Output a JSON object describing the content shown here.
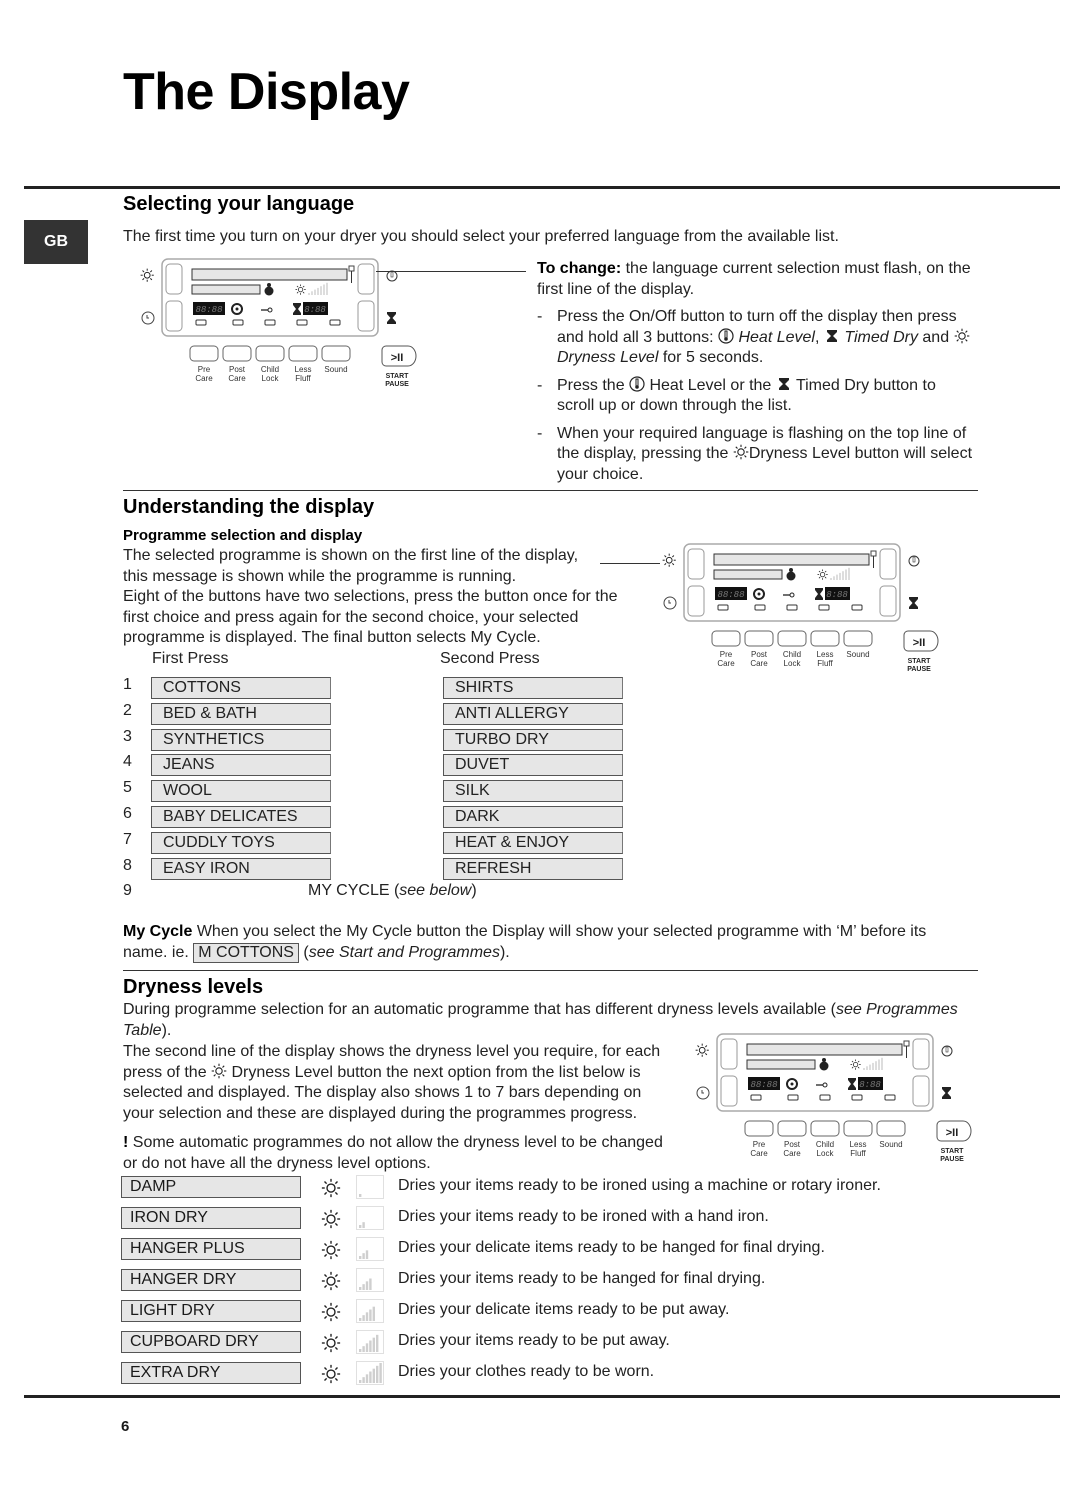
{
  "page": {
    "title": "The Display",
    "side_tab": "GB",
    "page_number": "6"
  },
  "language": {
    "heading": "Selecting your language",
    "intro": "The first time you turn on your dryer you should select your preferred language from the available list.",
    "to_change_label": "To change:",
    "to_change_text": " the language current selection must flash, on the first line of the display.",
    "steps": [
      {
        "dash": "-",
        "p1": "Press the On/Off button to turn off the display then press and hold all 3 buttons: ",
        "heat": "Heat Level",
        "comma": ", ",
        "timed": "Timed Dry",
        "and": " and ",
        "dryness": "Dryness Level",
        "tail": " for 5 seconds."
      },
      {
        "dash": "-",
        "p1": "Press the ",
        "p2": " Heat Level or the ",
        "p3": " Timed Dry button to scroll up or down through the list."
      },
      {
        "dash": "-",
        "p1": "When your required language is flashing on the top line of the display, pressing the ",
        "p2": "Dryness Level button will select your choice."
      }
    ]
  },
  "panel": {
    "buttons": [
      {
        "line1": "Pre",
        "line2": "Care"
      },
      {
        "line1": "Post",
        "line2": "Care"
      },
      {
        "line1": "Child",
        "line2": "Lock"
      },
      {
        "line1": "Less",
        "line2": "Fluff"
      },
      {
        "line1": "Sound",
        "line2": ""
      }
    ],
    "start_label_1": "START",
    "start_label_2": "PAUSE",
    "start_glyph": ">II",
    "digits_left": "88:88",
    "digits_right": "8:88",
    "icons": [
      "dryness-icon",
      "delay-icon",
      "heat-level-icon",
      "timed-dry-icon",
      "baby-icon",
      "refresh-cycle-icon",
      "key-lock-icon",
      "hourglass-icon",
      "signal-bars-icon"
    ]
  },
  "understanding": {
    "heading": "Understanding the display",
    "subheading": "Programme selection and display",
    "para": [
      "The selected programme is shown on the first line of the display,",
      "this message is shown while the programme is running.",
      "Eight of the buttons have two selections, press the button once for the",
      "first choice and press again for the second choice, your selected",
      "programme is displayed.  The final button selects My Cycle."
    ],
    "first_press_label": "First Press",
    "second_press_label": "Second Press",
    "programmes": [
      {
        "n": "1",
        "first": "COTTONS",
        "second": "SHIRTS"
      },
      {
        "n": "2",
        "first": "BED & BATH",
        "second": "ANTI ALLERGY"
      },
      {
        "n": "3",
        "first": "SYNTHETICS",
        "second": "TURBO DRY"
      },
      {
        "n": "4",
        "first": "JEANS",
        "second": "DUVET"
      },
      {
        "n": "5",
        "first": "WOOL",
        "second": "SILK"
      },
      {
        "n": "6",
        "first": "BABY DELICATES",
        "second": "DARK"
      },
      {
        "n": "7",
        "first": "CUDDLY TOYS",
        "second": "HEAT & ENJOY"
      },
      {
        "n": "8",
        "first": "EASY IRON",
        "second": "REFRESH"
      }
    ],
    "ninth": {
      "n": "9",
      "label": "MY CYCLE (",
      "see": "see below",
      "close": ")"
    },
    "mycycle_bold": "My Cycle",
    "mycycle_text": " When you select the My Cycle button the Display will show your selected programme with ‘M’ before its",
    "mycycle_text2": "name.  ie. ",
    "mycycle_example": "M  COTTONS",
    "mycycle_open": " (",
    "mycycle_see": "see Start and Programmes",
    "mycycle_close": ")."
  },
  "dryness": {
    "heading": "Dryness levels",
    "intro": "During programme selection for an automatic programme that has different dryness levels available (",
    "intro_see": "see Programmes",
    "intro_see2": "Table",
    "intro_close": ").",
    "para_lines": [
      "The second line of the display shows the dryness level you require, for each",
      "Dryness Level button the next option from the list below is",
      "selected and displayed. The display also shows 1 to 7 bars depending on",
      "your selection and these are displayed during the programmes progress."
    ],
    "para_press": "press of the ",
    "warning_mark": "!",
    "warning_line1": " Some automatic programmes do not allow the dryness level to be changed",
    "warning_line2": "or do not have all the dryness level options.",
    "levels": [
      {
        "name": "DAMP",
        "bars": 1,
        "desc": "Dries your items ready to be ironed using a machine or rotary ironer."
      },
      {
        "name": "IRON DRY",
        "bars": 2,
        "desc": "Dries your items ready to be ironed with a hand iron."
      },
      {
        "name": "HANGER PLUS",
        "bars": 3,
        "desc": "Dries your delicate items ready to be hanged for final drying."
      },
      {
        "name": "HANGER DRY",
        "bars": 4,
        "desc": "Dries your items ready to be hanged for final drying."
      },
      {
        "name": "LIGHT DRY",
        "bars": 5,
        "desc": "Dries your delicate items ready to be put away."
      },
      {
        "name": "CUPBOARD DRY",
        "bars": 6,
        "desc": "Dries your items ready to be put away."
      },
      {
        "name": "EXTRA DRY",
        "bars": 7,
        "desc": "Dries your clothes ready to be worn."
      }
    ],
    "max_bars": 7
  },
  "colors": {
    "lcd_fill": "#e6e6e6",
    "side_tab_bg": "#333333",
    "digit_bg": "#111111",
    "bar_fill": "#cfcfcf"
  }
}
